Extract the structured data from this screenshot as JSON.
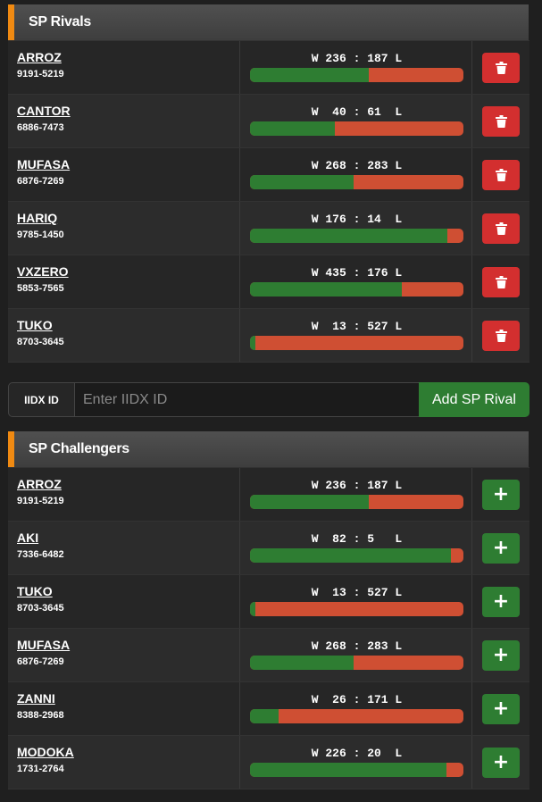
{
  "rivals_section": {
    "title": "SP Rivals",
    "rows": [
      {
        "name": "ARROZ",
        "iidx_id": "9191-5219",
        "record": "W 236 : 187 L",
        "win_fraction": 0.558
      },
      {
        "name": "CANTOR",
        "iidx_id": "6886-7473",
        "record": "W  40 : 61  L",
        "win_fraction": 0.396
      },
      {
        "name": "MUFASA",
        "iidx_id": "6876-7269",
        "record": "W 268 : 283 L",
        "win_fraction": 0.486
      },
      {
        "name": "HARIQ",
        "iidx_id": "9785-1450",
        "record": "W 176 : 14  L",
        "win_fraction": 0.926
      },
      {
        "name": "VXZERO",
        "iidx_id": "5853-7565",
        "record": "W 435 : 176 L",
        "win_fraction": 0.712
      },
      {
        "name": "TUKO",
        "iidx_id": "8703-3645",
        "record": "W  13 : 527 L",
        "win_fraction": 0.024
      }
    ],
    "row_action_icon": "trash-icon"
  },
  "add_rival_form": {
    "label": "IIDX ID",
    "placeholder": "Enter IIDX ID",
    "value": "",
    "button_label": "Add SP Rival"
  },
  "challengers_section": {
    "title": "SP Challengers",
    "rows": [
      {
        "name": "ARROZ",
        "iidx_id": "9191-5219",
        "record": "W 236 : 187 L",
        "win_fraction": 0.558
      },
      {
        "name": "AKI",
        "iidx_id": "7336-6482",
        "record": "W  82 : 5   L",
        "win_fraction": 0.943
      },
      {
        "name": "TUKO",
        "iidx_id": "8703-3645",
        "record": "W  13 : 527 L",
        "win_fraction": 0.024
      },
      {
        "name": "MUFASA",
        "iidx_id": "6876-7269",
        "record": "W 268 : 283 L",
        "win_fraction": 0.486
      },
      {
        "name": "ZANNI",
        "iidx_id": "8388-2968",
        "record": "W  26 : 171 L",
        "win_fraction": 0.132
      },
      {
        "name": "MODOKA",
        "iidx_id": "1731-2764",
        "record": "W 226 : 20  L",
        "win_fraction": 0.919
      }
    ],
    "row_action_label": "+",
    "row_action_icon": "plus-icon"
  },
  "colors": {
    "accent": "#f08a12",
    "win": "#2e7d32",
    "loss": "#cf4f33",
    "delete": "#d32f2f",
    "add": "#2e7d32"
  }
}
